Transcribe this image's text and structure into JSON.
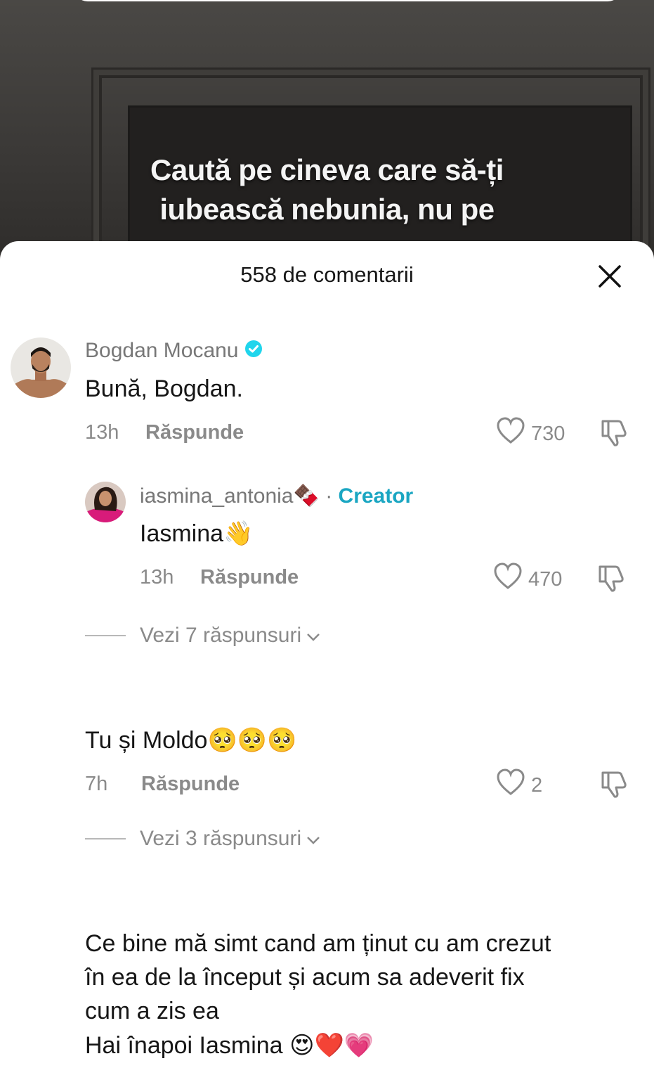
{
  "video": {
    "caption_line1": "Caută pe cineva care să-ți",
    "caption_line2": "iubească nebunia, nu pe"
  },
  "sheet": {
    "title": "558 de comentarii"
  },
  "comments": [
    {
      "username": "Bogdan Mocanu",
      "verified": true,
      "text": "Bună, Bogdan.",
      "time": "13h",
      "reply_label": "Răspunde",
      "likes": "730"
    }
  ],
  "reply": {
    "username": "iasmina_antonia",
    "username_emoji": "🍫",
    "separator": "·",
    "creator_badge": "Creator",
    "text": "Iasmina",
    "text_emoji": "👋",
    "time": "13h",
    "reply_label": "Răspunde",
    "likes": "470"
  },
  "view_replies_1": "Vezi 7 răspunsuri",
  "comment2": {
    "text": "Tu și Moldo",
    "emojis": "🥺🥺🥺",
    "time": "7h",
    "reply_label": "Răspunde",
    "likes": "2"
  },
  "view_replies_2": "Vezi 3 răspunsuri",
  "comment3": {
    "line1": "Ce bine mă simt cand am ținut cu am crezut",
    "line2": "în ea de la început și acum sa adeverit fix",
    "line3": "cum a zis ea",
    "line4": "Hai înapoi Iasmina",
    "line4_emojis": "😍❤️💗"
  },
  "colors": {
    "accent_creator": "#1aa6c2",
    "verified_badge": "#20d5ec",
    "meta_grey": "#8a8a8a"
  },
  "icons": [
    "close-icon",
    "verified-icon",
    "heart-icon",
    "dislike-icon",
    "chevron-down-icon"
  ]
}
